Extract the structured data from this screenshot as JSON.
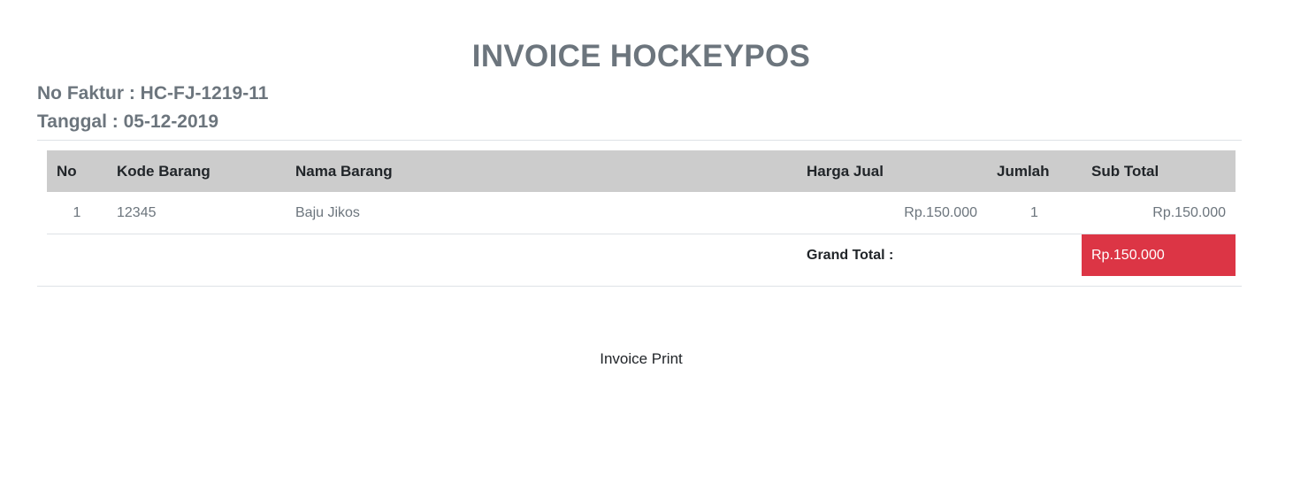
{
  "invoice": {
    "title": "INVOICE HOCKEYPOS",
    "no_faktur": "No Faktur : HC-FJ-1219-11",
    "tanggal": "Tanggal : 05-12-2019"
  },
  "table": {
    "headers": {
      "no": "No",
      "kode": "Kode Barang",
      "nama": "Nama Barang",
      "harga": "Harga Jual",
      "jumlah": "Jumlah",
      "subtotal": "Sub Total"
    },
    "rows": [
      {
        "no": "1",
        "kode": "12345",
        "nama": "Baju Jikos",
        "harga": "Rp.150.000",
        "jumlah": "1",
        "subtotal": "Rp.150.000"
      }
    ],
    "grand_total_label": "Grand Total :",
    "grand_total_value": "Rp.150.000"
  },
  "footer": {
    "text": "Invoice Print"
  },
  "colors": {
    "grand_total_bg": "#dc3545",
    "header_bg": "#cccccc",
    "muted_text": "#6c757d"
  }
}
